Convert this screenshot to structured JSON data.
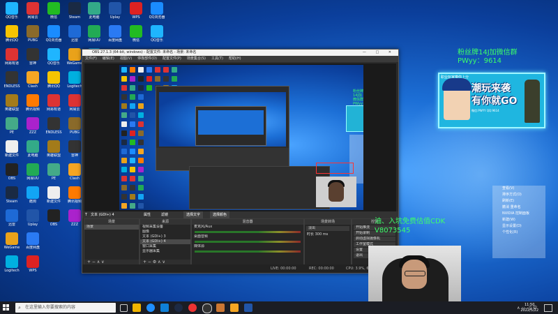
{
  "desktop": {
    "icons": [
      {
        "label": "QQ音乐",
        "color": "#1fb5ff"
      },
      {
        "label": "腾讯QQ",
        "color": "#f6c400"
      },
      {
        "label": "网易有道",
        "color": "#d33"
      },
      {
        "label": "ENDLESS",
        "color": "#333"
      },
      {
        "label": "英雄联盟",
        "color": "#a37b1a"
      },
      {
        "label": "PE",
        "color": "#4a8"
      },
      {
        "label": "新建文件",
        "color": "#eee"
      },
      {
        "label": "OBS",
        "color": "#222"
      },
      {
        "label": "Steam",
        "color": "#1a2a44"
      },
      {
        "label": "迅雷",
        "color": "#1e6ad6"
      },
      {
        "label": "WeGame",
        "color": "#e9a21a"
      },
      {
        "label": "Logitech",
        "color": "#00b0e0"
      },
      {
        "label": "网易云",
        "color": "#d33"
      },
      {
        "label": "PUBG",
        "color": "#8a6a2a"
      },
      {
        "label": "雷神",
        "color": "#333"
      },
      {
        "label": "Clash",
        "color": "#f5a623"
      },
      {
        "label": "腾讯视频",
        "color": "#ff7a00"
      },
      {
        "label": "ZZZ",
        "color": "#a2c"
      },
      {
        "label": "此电脑",
        "color": "#3a8"
      },
      {
        "label": "网易UU",
        "color": "#2a5"
      },
      {
        "label": "酷狗",
        "color": "#12a5f5"
      },
      {
        "label": "Uplay",
        "color": "#2155a8"
      },
      {
        "label": "百度网盘",
        "color": "#2a7af3"
      },
      {
        "label": "WPS",
        "color": "#d22"
      },
      {
        "label": "微信",
        "color": "#2b2"
      },
      {
        "label": "QQ浏览器",
        "color": "#1a8cff"
      }
    ]
  },
  "obs": {
    "title": "OBS 27.1.3 (64-bit, windows) - 配置文件: 未命名 - 场景: 未命名",
    "menu": [
      "文件(F)",
      "编辑(E)",
      "视图(V)",
      "停靠部件(D)",
      "配置文件(P)",
      "场景集合(S)",
      "工具(T)",
      "帮助(H)"
    ],
    "preview_fan_line1": "粉丝牌14J加微信群",
    "preview_fan_line2": "PWyy: 9614",
    "dock_bar": {
      "source_label": "文本 (GDI+) 4",
      "props": "属性",
      "filters": "滤镜",
      "select_text": "选择文字",
      "clear": "选择颜色"
    },
    "scenes": {
      "header": "场景",
      "items": [
        "场景"
      ]
    },
    "sources": {
      "header": "来源",
      "items": [
        "视频采集设备",
        "图像",
        "文本 (GDI+) 3",
        "文本 (GDI+) 4",
        "窗口采集",
        "显示器采集"
      ]
    },
    "mixer": {
      "header": "混音器",
      "items": [
        "麦克风/Aux",
        "桌面音频",
        "媒体源"
      ]
    },
    "transitions": {
      "header": "场景转场",
      "fade": "淡出",
      "duration_label": "时长",
      "duration_value": "300 ms"
    },
    "controls": {
      "header": "控件",
      "items": [
        "开始推流",
        "开始录制",
        "启动虚拟摄像机",
        "工作室模式",
        "设置",
        "退出"
      ]
    },
    "status": {
      "live": "LIVE: 00:00:00",
      "rec": "REC: 00:00:00",
      "cpu": "CPU: 3.9%, 60.00 fps"
    }
  },
  "overlay": {
    "fan_line1": "粉丝牌14J加微信群",
    "fan_line2": "PWyy：9614",
    "banner_top": "职业玩家带你上分",
    "banner_big1": "潮玩来袭",
    "banner_big2": "有你就GO",
    "banner_info": "微信:PWYY  QQ:9614",
    "cdk_line1": "油、入坑免费估值CDK",
    "cdk_line2": "V8073545"
  },
  "context_menu": {
    "items": [
      "查看(V)",
      "排序方式(O)",
      "刷新(E)",
      "撤消 重命名",
      "NVIDIA 控制面板",
      "新建(W)",
      "显示设置(D)",
      "个性化(R)"
    ]
  },
  "taskbar": {
    "search_placeholder": "在这里输入你要搜索的内容",
    "time": "11:50",
    "date": "2022/5/22",
    "lang": "中"
  }
}
